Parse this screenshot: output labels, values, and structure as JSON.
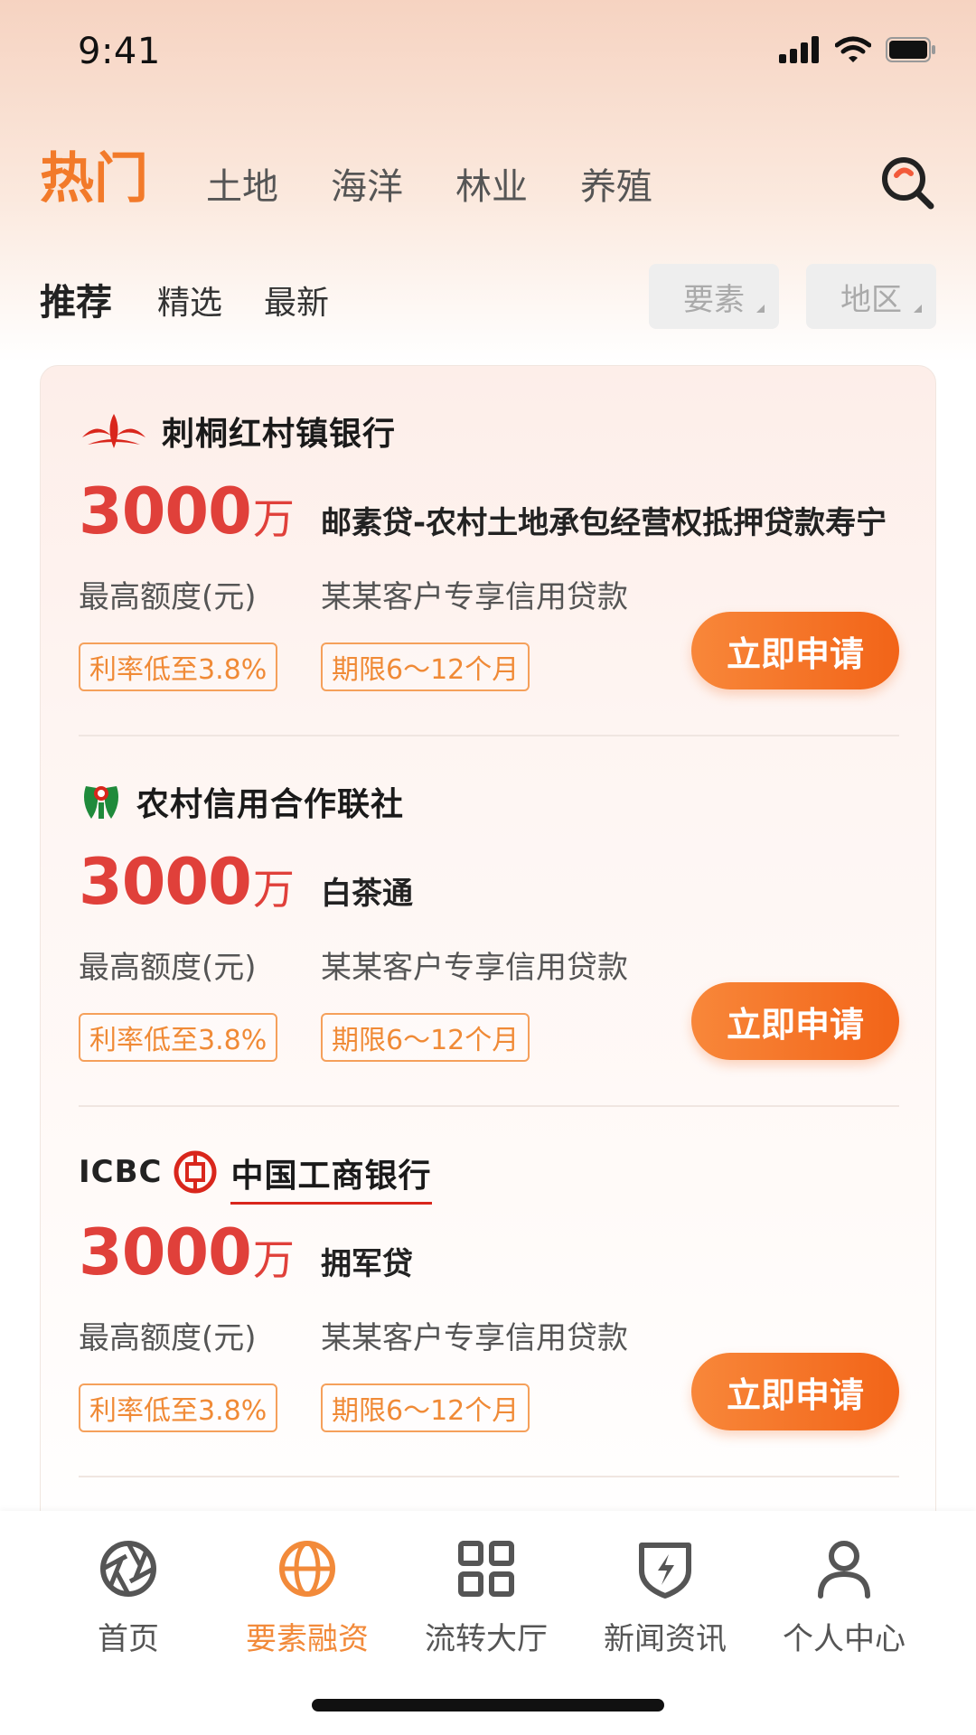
{
  "status_bar": {
    "time": "9:41"
  },
  "category_nav": {
    "items": [
      {
        "label": "热门",
        "active": true
      },
      {
        "label": "土地"
      },
      {
        "label": "海洋"
      },
      {
        "label": "林业"
      },
      {
        "label": "养殖"
      }
    ]
  },
  "sub_tabs": [
    {
      "label": "推荐",
      "active": true
    },
    {
      "label": "精选"
    },
    {
      "label": "最新"
    }
  ],
  "filters": [
    {
      "label": "要素"
    },
    {
      "label": "地区"
    }
  ],
  "loans": [
    {
      "bank": "刺桐红村镇银行",
      "amount": "3000",
      "unit": "万",
      "product": "邮素贷-农村土地承包经营权抵押贷款寿宁",
      "max_label": "最高额度(元)",
      "desc": "某某客户专享信用贷款",
      "tags": [
        "利率低至3.8%",
        "期限6～12个月"
      ],
      "button": "立即申请"
    },
    {
      "bank": "农村信用合作联社",
      "amount": "3000",
      "unit": "万",
      "product": "白茶通",
      "max_label": "最高额度(元)",
      "desc": "某某客户专享信用贷款",
      "tags": [
        "利率低至3.8%",
        "期限6～12个月"
      ],
      "button": "立即申请"
    },
    {
      "bank": "中国工商银行",
      "bank_prefix": "ICBC",
      "amount": "3000",
      "unit": "万",
      "product": "拥军贷",
      "max_label": "最高额度(元)",
      "desc": "某某客户专享信用贷款",
      "tags": [
        "利率低至3.8%",
        "期限6～12个月"
      ],
      "button": "立即申请"
    }
  ],
  "tab_bar": {
    "items": [
      {
        "label": "首页",
        "icon": "aperture-icon"
      },
      {
        "label": "要素融资",
        "icon": "globe-icon",
        "active": true
      },
      {
        "label": "流转大厅",
        "icon": "grid-icon"
      },
      {
        "label": "新闻资讯",
        "icon": "shield-bolt-icon"
      },
      {
        "label": "个人中心",
        "icon": "person-icon"
      }
    ]
  },
  "colors": {
    "accent": "#f27a2a",
    "amount_red": "#e0403a",
    "tag_orange": "#f08a36"
  }
}
